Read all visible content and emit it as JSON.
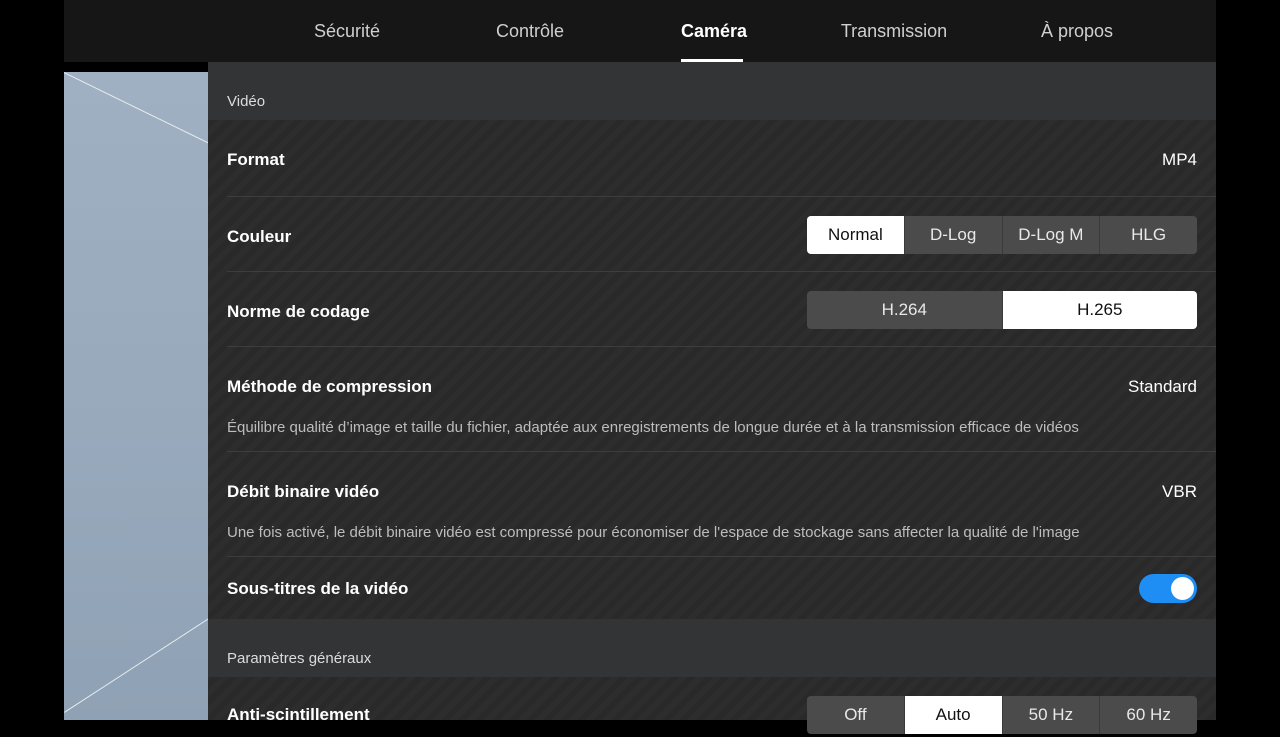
{
  "tabs": [
    {
      "label": "Sécurité",
      "active": false
    },
    {
      "label": "Contrôle",
      "active": false
    },
    {
      "label": "Caméra",
      "active": true
    },
    {
      "label": "Transmission",
      "active": false
    },
    {
      "label": "À propos",
      "active": false
    }
  ],
  "video_section": {
    "title": "Vidéo",
    "format": {
      "label": "Format",
      "value": "MP4"
    },
    "color": {
      "label": "Couleur",
      "options": [
        "Normal",
        "D-Log",
        "D-Log M",
        "HLG"
      ],
      "selected": "Normal"
    },
    "codec": {
      "label": "Norme de codage",
      "options": [
        "H.264",
        "H.265"
      ],
      "selected": "H.265"
    },
    "compression": {
      "label": "Méthode de compression",
      "value": "Standard",
      "description": "Équilibre qualité d’image et taille du fichier, adaptée aux enregistrements de longue durée et à la transmission efficace de vidéos"
    },
    "bitrate": {
      "label": "Débit binaire vidéo",
      "value": "VBR",
      "description": "Une fois activé, le débit binaire vidéo est compressé pour économiser de l'espace de stockage sans affecter la qualité de l'image"
    },
    "subtitles": {
      "label": "Sous-titres de la vidéo",
      "enabled": true
    }
  },
  "general_section": {
    "title": "Paramètres généraux",
    "antiflicker": {
      "label": "Anti-scintillement",
      "options": [
        "Off",
        "Auto",
        "50 Hz",
        "60 Hz"
      ],
      "selected": "Auto"
    }
  },
  "colors": {
    "accent_toggle": "#1e8ef5",
    "selected_segment": "#ffffff"
  }
}
